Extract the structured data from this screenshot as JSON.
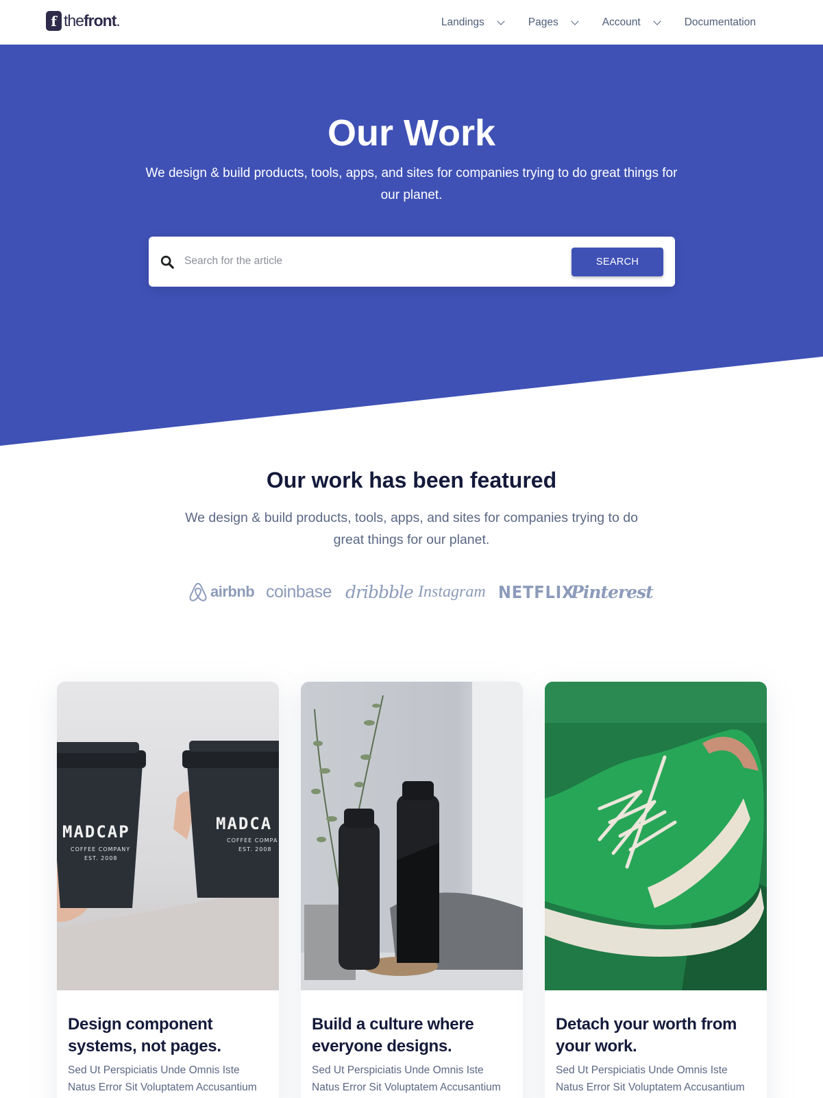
{
  "header": {
    "logo_mark": "f",
    "logo_text_light": "the",
    "logo_text_bold": "front",
    "nav": [
      {
        "label": "Landings",
        "has_dropdown": true
      },
      {
        "label": "Pages",
        "has_dropdown": true
      },
      {
        "label": "Account",
        "has_dropdown": true
      },
      {
        "label": "Documentation",
        "has_dropdown": false
      }
    ]
  },
  "hero": {
    "title": "Our Work",
    "subtitle": "We design & build products, tools, apps, and sites for companies trying to do great things for our planet.",
    "search_placeholder": "Search for the article",
    "search_button": "SEARCH",
    "accent_color": "#3f51b5"
  },
  "featured": {
    "title": "Our work has been featured",
    "subtitle": "We design & build products, tools, apps, and sites for companies trying to do great things for our planet.",
    "brands": [
      "airbnb",
      "coinbase",
      "dribbble",
      "Instagram",
      "NETFLIX",
      "Pinterest"
    ]
  },
  "cards": [
    {
      "title": "Design component systems, not pages.",
      "text": "Sed Ut Perspiciatis Unde Omnis Iste Natus Error Sit Voluptatem Accusantium",
      "image": "madcap-coffee-cups"
    },
    {
      "title": "Build a culture where everyone designs.",
      "text": "Sed Ut Perspiciatis Unde Omnis Iste Natus Error Sit Voluptatem Accusantium",
      "image": "black-bottles-plant"
    },
    {
      "title": "Detach your worth from your work.",
      "text": "Sed Ut Perspiciatis Unde Omnis Iste Natus Error Sit Voluptatem Accusantium",
      "image": "green-sneaker"
    }
  ]
}
